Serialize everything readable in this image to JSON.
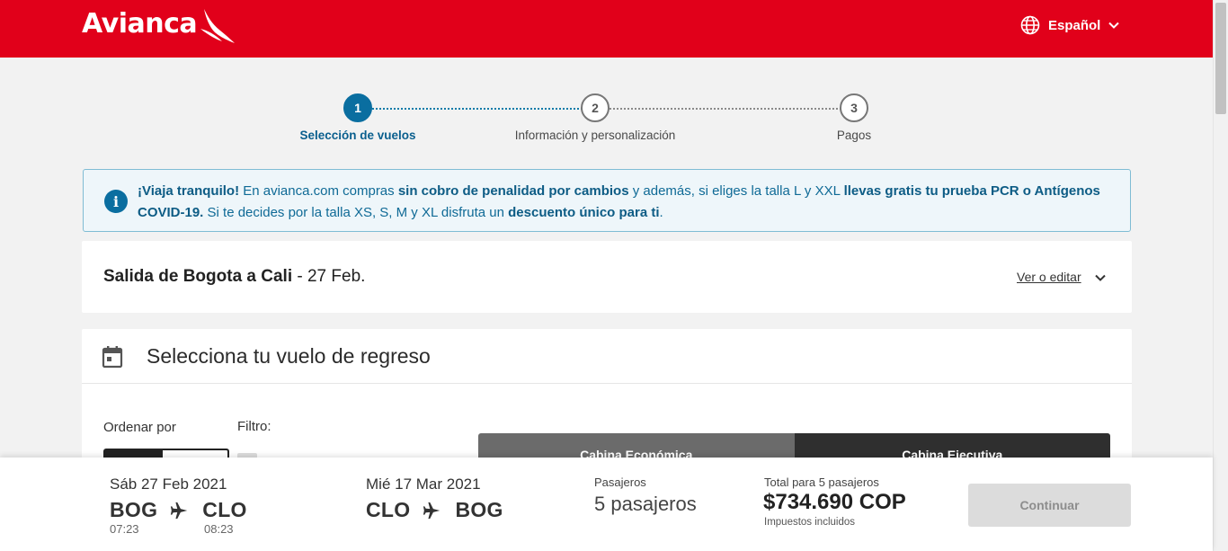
{
  "header": {
    "brand": "Avianca",
    "language": "Español",
    "brand_color": "#e1001a"
  },
  "stepper": {
    "steps": [
      {
        "number": "1",
        "label": "Selección de vuelos",
        "active": true
      },
      {
        "number": "2",
        "label": "Información y personalización",
        "active": false
      },
      {
        "number": "3",
        "label": "Pagos",
        "active": false
      }
    ]
  },
  "banner": {
    "icon": "info-icon",
    "parts": [
      {
        "text": "¡Viaja tranquilo!",
        "bold": true
      },
      {
        "text": " En avianca.com compras ",
        "bold": false
      },
      {
        "text": "sin cobro de penalidad por cambios",
        "bold": true
      },
      {
        "text": " y además, si eliges la talla L y XXL ",
        "bold": false
      },
      {
        "text": "llevas gratis tu prueba PCR o Antígenos COVID-19.",
        "bold": true
      },
      {
        "text": " Si te decides por la talla XS, S, M y XL disfruta un ",
        "bold": false
      },
      {
        "text": "descuento único para ti",
        "bold": true
      },
      {
        "text": ".",
        "bold": false
      }
    ]
  },
  "outbound": {
    "title_bold": "Salida de Bogota a Cali",
    "title_rest": " - 27 Feb.",
    "edit_link": "Ver o editar"
  },
  "return_section": {
    "title": "Selecciona tu vuelo de regreso",
    "sort_label": "Ordenar por",
    "filter_label": "Filtro:",
    "cabins": [
      "Cabina Económica",
      "Cabina Ejecutiva"
    ]
  },
  "summary": {
    "outbound": {
      "date": "Sáb 27 Feb 2021",
      "from": "BOG",
      "to": "CLO",
      "dep_time": "07:23",
      "arr_time": "08:23"
    },
    "return": {
      "date": "Mié 17 Mar 2021",
      "from": "CLO",
      "to": "BOG"
    },
    "passengers_label": "Pasajeros",
    "passengers_value": "5 pasajeros",
    "total_label": "Total para 5 pasajeros",
    "total_value": "$734.690 COP",
    "tax_note": "Impuestos incluidos",
    "continue_label": "Continuar"
  }
}
